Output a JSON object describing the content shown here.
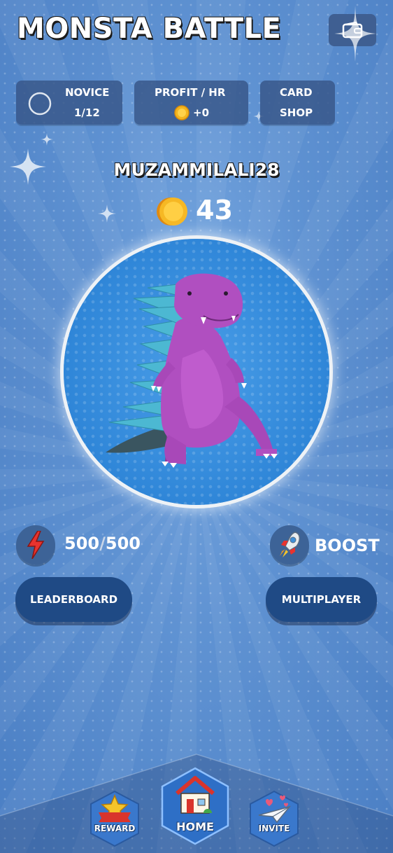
{
  "app": {
    "title": "MONSTA BATTLE"
  },
  "header": {
    "wallet_icon": "wallet-icon"
  },
  "stats": {
    "rank_name": "NOVICE",
    "rank_progress": "1/12",
    "profit_label": "PROFIT / HR",
    "profit_value": "+0",
    "shop_line1": "CARD",
    "shop_line2": "SHOP"
  },
  "player": {
    "username": "MUZAMMILALI28",
    "coins": "43"
  },
  "energy": {
    "current": "500",
    "separator": "/",
    "max": "500"
  },
  "boost": {
    "label": "BOOST"
  },
  "actions": {
    "leaderboard": "LEADERBOARD",
    "multiplayer": "MULTIPLAYER"
  },
  "nav": {
    "reward": "REWARD",
    "home": "HOME",
    "invite": "INVITE"
  },
  "colors": {
    "background": "#5f92d2",
    "card": "#37558a",
    "pill": "#1f4a85",
    "coin": "#f3b51e",
    "monster": "#b04fc0"
  }
}
